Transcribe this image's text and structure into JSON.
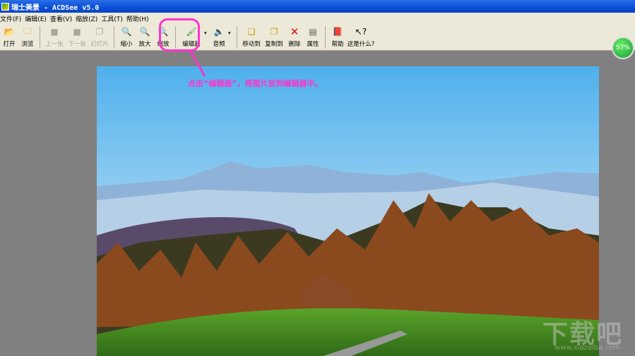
{
  "window": {
    "title": "瑞士美景 - ACDSee v5.0"
  },
  "menu": [
    "文件(F)",
    "编辑(E)",
    "查看(V)",
    "缩放(Z)",
    "工具(T)",
    "帮助(H)"
  ],
  "toolbar": {
    "open": "打开",
    "browse": "浏览",
    "prev": "上一张",
    "next": "下一张",
    "slideshow": "幻灯片",
    "zoom_out": "缩小",
    "zoom_in": "放大",
    "zoom": "缩放",
    "editor": "编辑器",
    "audio": "音频",
    "move_to": "移动到",
    "copy_to": "复制到",
    "delete": "删除",
    "properties": "属性",
    "help": "帮助",
    "whats_this": "这是什么?"
  },
  "zoom_badge": "57%",
  "annotation": "点击“编辑器”，将图片放到编辑器中。",
  "watermark": {
    "text": "下载吧",
    "url": "www.xiazaiba.com"
  }
}
